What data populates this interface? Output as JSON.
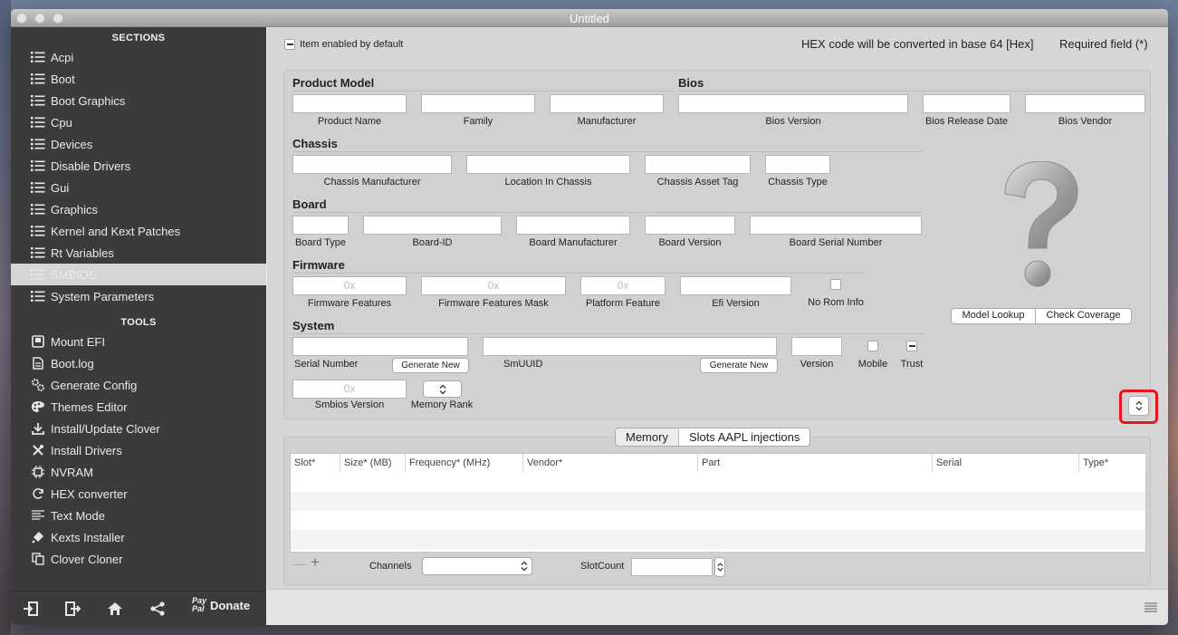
{
  "window": {
    "title": "Untitled"
  },
  "sidebar": {
    "sections_header": "SECTIONS",
    "sections": [
      {
        "label": "Acpi",
        "icon": "list-icon"
      },
      {
        "label": "Boot",
        "icon": "list-icon"
      },
      {
        "label": "Boot Graphics",
        "icon": "list-icon"
      },
      {
        "label": "Cpu",
        "icon": "list-icon"
      },
      {
        "label": "Devices",
        "icon": "list-icon"
      },
      {
        "label": "Disable Drivers",
        "icon": "list-icon"
      },
      {
        "label": "Gui",
        "icon": "list-icon"
      },
      {
        "label": "Graphics",
        "icon": "list-icon"
      },
      {
        "label": "Kernel and Kext Patches",
        "icon": "list-icon"
      },
      {
        "label": "Rt Variables",
        "icon": "list-icon"
      },
      {
        "label": "SMBIOS",
        "icon": "list-icon",
        "selected": true
      },
      {
        "label": "System Parameters",
        "icon": "list-icon"
      }
    ],
    "tools_header": "TOOLS",
    "tools": [
      {
        "label": "Mount EFI",
        "icon": "disk-icon"
      },
      {
        "label": "Boot.log",
        "icon": "document-icon"
      },
      {
        "label": "Generate Config",
        "icon": "gears-icon"
      },
      {
        "label": "Themes Editor",
        "icon": "palette-icon"
      },
      {
        "label": "Install/Update Clover",
        "icon": "download-icon"
      },
      {
        "label": "Install Drivers",
        "icon": "tools-icon"
      },
      {
        "label": "NVRAM",
        "icon": "chip-icon"
      },
      {
        "label": "HEX converter",
        "icon": "refresh-icon"
      },
      {
        "label": "Text Mode",
        "icon": "text-lines-icon"
      },
      {
        "label": "Kexts Installer",
        "icon": "plug-icon"
      },
      {
        "label": "Clover Cloner",
        "icon": "copy-icon"
      }
    ],
    "bottom": {
      "paypal_line1": "Pay",
      "paypal_line2": "Pal",
      "donate_label": "Donate"
    }
  },
  "header": {
    "item_enabled_label": "Item enabled by default",
    "hex_note": "HEX code will be converted in base 64 [Hex]",
    "required_note": "Required field (*)"
  },
  "smbios": {
    "product_model": {
      "title": "Product Model",
      "product_name": "Product Name",
      "family": "Family",
      "manufacturer": "Manufacturer"
    },
    "bios": {
      "title": "Bios",
      "version": "Bios Version",
      "release_date": "Bios Release Date",
      "vendor": "Bios Vendor"
    },
    "chassis": {
      "title": "Chassis",
      "manufacturer": "Chassis Manufacturer",
      "location": "Location In Chassis",
      "asset_tag": "Chassis  Asset Tag",
      "type": "Chassis Type"
    },
    "board": {
      "title": "Board",
      "type": "Board Type",
      "id": "Board-ID",
      "manufacturer": "Board Manufacturer",
      "version": "Board Version",
      "serial": "Board Serial Number"
    },
    "firmware": {
      "title": "Firmware",
      "features": "Firmware Features",
      "features_placeholder": "0x",
      "features_mask": "Firmware Features Mask",
      "features_mask_placeholder": "0x",
      "platform_feature": "Platform Feature",
      "platform_feature_placeholder": "0x",
      "efi_version": "Efi Version",
      "no_rom_info": "No Rom Info"
    },
    "system": {
      "title": "System",
      "serial_number": "Serial Number",
      "generate_new_1": "Generate New",
      "smuuid": "SmUUID",
      "generate_new_2": "Generate New",
      "version": "Version",
      "mobile": "Mobile",
      "trust": "Trust",
      "smbios_version": "Smbios Version",
      "smbios_version_placeholder": "0x",
      "memory_rank": "Memory Rank"
    },
    "buttons": {
      "model_lookup": "Model Lookup",
      "check_coverage": "Check Coverage"
    }
  },
  "memory": {
    "tabs": [
      "Memory",
      "Slots AAPL injections"
    ],
    "columns": [
      "Slot*",
      "Size* (MB)",
      "Frequency* (MHz)",
      "Vendor*",
      "Part",
      "Serial",
      "Type*"
    ],
    "add_label": "+",
    "remove_label": "—",
    "channels_label": "Channels",
    "slotcount_label": "SlotCount"
  },
  "colors": {
    "sidebar_bg": "#3b3b3b",
    "selected_bg": "#d5d5d5",
    "highlight": "#e0171d"
  }
}
